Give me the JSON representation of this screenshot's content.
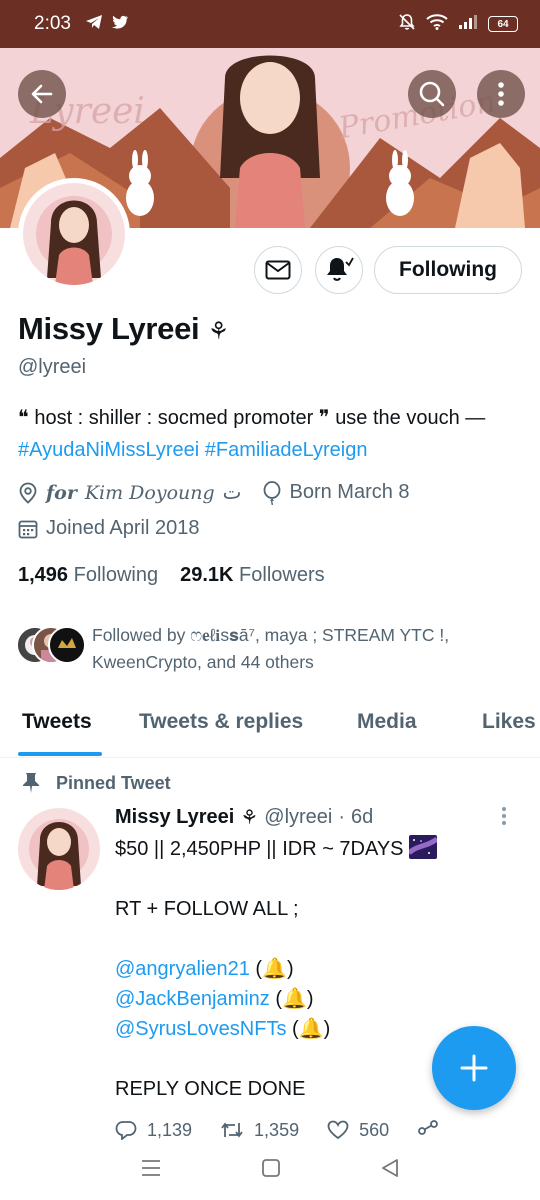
{
  "status_bar": {
    "time": "2:03",
    "left_icons": [
      "telegram-icon",
      "twitter-icon"
    ],
    "right_icons": [
      "bell-muted-icon",
      "wifi-icon",
      "signal-icon"
    ],
    "battery": "64"
  },
  "banner": {
    "watermark_left": "Lyreei",
    "watermark_right": "Promotion"
  },
  "profile": {
    "name": "Missy Lyreei",
    "name_emoji": "⚘",
    "handle": "@lyreei",
    "bio_text": "❝ host : shiller : socmed promoter ❞ use the vouch — ",
    "bio_hashtag_1": "#AyudaNiMissLyreei",
    "bio_hashtag_2": "#FamiliadeLyreign",
    "location_for": "for",
    "location_name": "Kim Doyoung",
    "location_suffix": "ت",
    "birthday": "Born March 8",
    "joined": "Joined April 2018",
    "following_count": "1,496",
    "following_label": "Following",
    "followers_count": "29.1K",
    "followers_label": "Followers",
    "followed_by_line1": "Followed by ෆ𝐞ℓ𝐢ѕ𝐬ā⁷, maya ; STREAM YTC !,",
    "followed_by_line2": "KweenCrypto, and 44 others"
  },
  "actions": {
    "following_button": "Following",
    "icons": [
      "mail-icon",
      "bell-subscribed-icon"
    ]
  },
  "tabs": [
    {
      "label": "Tweets",
      "active": true
    },
    {
      "label": "Tweets & replies",
      "active": false
    },
    {
      "label": "Media",
      "active": false
    },
    {
      "label": "Likes",
      "active": false
    }
  ],
  "tweet": {
    "pinned_label": "Pinned Tweet",
    "author_name": "Missy Lyreei",
    "author_emoji": "⚘",
    "author_handle": "@lyreei",
    "separator": "·",
    "time": "6d",
    "line_1": "$50 || 2,450PHP || IDR ~ 7DAYS",
    "line_2": "RT + FOLLOW ALL ;",
    "mention_1": "@angryalien21",
    "mention_1_suffix": " (🔔)",
    "mention_2": "@JackBenjaminz",
    "mention_2_suffix": " (🔔)",
    "mention_3": "@SyrusLovesNFTs",
    "mention_3_suffix": " (🔔)",
    "line_3": "REPLY ONCE DONE",
    "replies": "1,139",
    "retweets": "1,359",
    "likes": "560"
  },
  "colors": {
    "accent": "#1d9bf0",
    "status_bar": "#6b2f24",
    "text_primary": "#0f1419",
    "text_secondary": "#536471",
    "banner_bg": "#f3d3d6"
  }
}
